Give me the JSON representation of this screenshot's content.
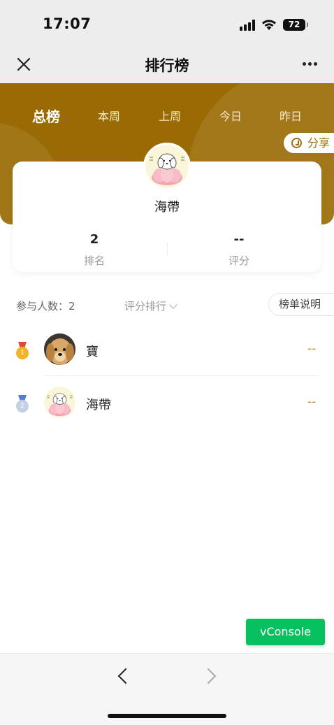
{
  "status": {
    "time": "17:07",
    "battery": "72"
  },
  "nav": {
    "title": "排行榜"
  },
  "tabs": [
    {
      "label": "总榜",
      "active": true
    },
    {
      "label": "本周",
      "active": false
    },
    {
      "label": "上周",
      "active": false
    },
    {
      "label": "今日",
      "active": false
    },
    {
      "label": "昨日",
      "active": false
    }
  ],
  "share_label": "分享",
  "profile": {
    "name": "海帶",
    "rank_value": "2",
    "rank_label": "排名",
    "score_value": "--",
    "score_label": "评分"
  },
  "filter": {
    "participants": "参与人数：2",
    "sort_label": "评分排行",
    "rules_label": "榜单说明"
  },
  "rows": [
    {
      "name": "寶",
      "score": "--",
      "medal": "gold",
      "medal_number": "1"
    },
    {
      "name": "海帶",
      "score": "--",
      "medal": "silver",
      "medal_number": "2"
    }
  ],
  "vconsole_label": "vConsole",
  "colors": {
    "accent": "#9a6b04",
    "score": "#c08a2a",
    "vconsole": "#07c160"
  }
}
